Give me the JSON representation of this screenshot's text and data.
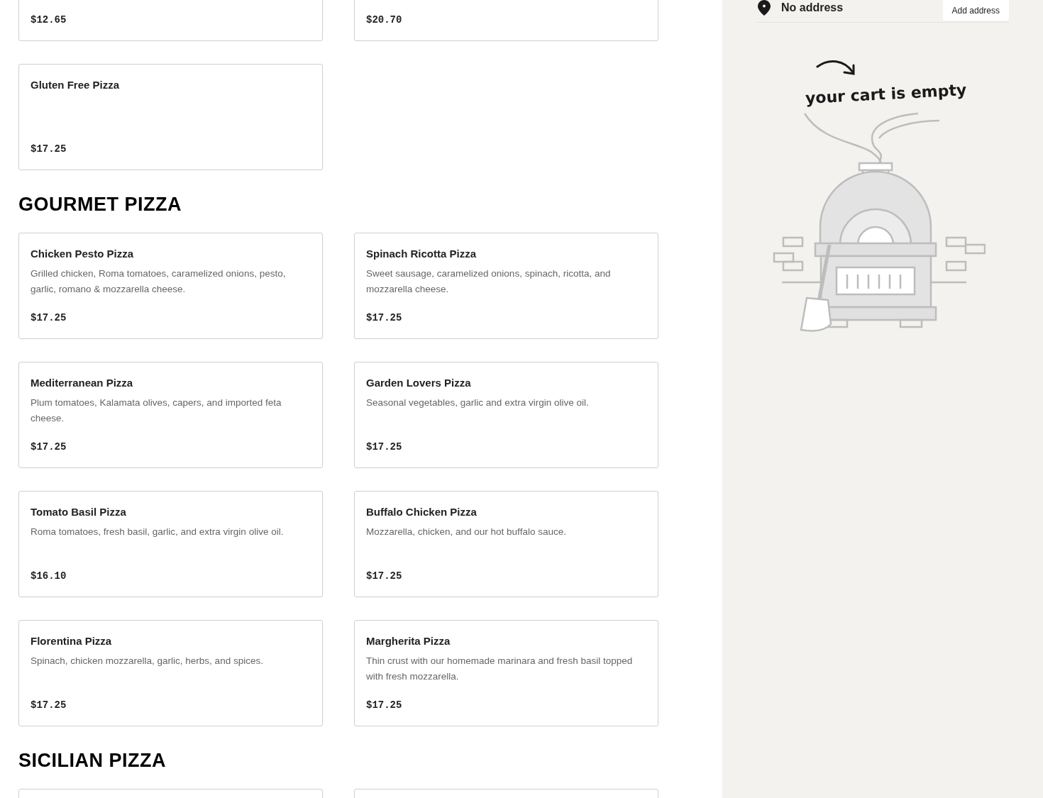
{
  "menu_sections": [
    {
      "items": [
        {
          "price": "$12.65"
        },
        {
          "price": "$20.70"
        },
        {
          "name": "Gluten Free Pizza",
          "price": "$17.25"
        }
      ]
    },
    {
      "title": "GOURMET PIZZA",
      "items": [
        {
          "name": "Chicken Pesto Pizza",
          "description": "Grilled chicken, Roma tomatoes, caramelized onions, pesto, garlic, romano & mozzarella cheese.",
          "price": "$17.25"
        },
        {
          "name": "Spinach Ricotta Pizza",
          "description": "Sweet sausage, caramelized onions, spinach, ricotta, and mozzarella cheese.",
          "price": "$17.25"
        },
        {
          "name": "Mediterranean Pizza",
          "description": "Plum tomatoes, Kalamata olives, capers, and imported feta cheese.",
          "price": "$17.25"
        },
        {
          "name": "Garden Lovers Pizza",
          "description": "Seasonal vegetables, garlic and extra virgin olive oil.",
          "price": "$17.25"
        },
        {
          "name": "Tomato Basil Pizza",
          "description": "Roma tomatoes, fresh basil, garlic, and extra virgin olive oil.",
          "price": "$16.10"
        },
        {
          "name": "Buffalo Chicken Pizza",
          "description": "Mozzarella, chicken, and our hot buffalo sauce.",
          "price": "$17.25"
        },
        {
          "name": "Florentina Pizza",
          "description": "Spinach, chicken mozzarella, garlic, herbs, and spices.",
          "price": "$17.25"
        },
        {
          "name": "Margherita Pizza",
          "description": "Thin crust with our homemade marinara and fresh basil topped with fresh mozzarella.",
          "price": "$17.25"
        }
      ]
    },
    {
      "title": "SICILIAN PIZZA"
    }
  ],
  "cart": {
    "address": "No address",
    "add_address_button": "Add address",
    "empty_message": "your cart is empty"
  }
}
